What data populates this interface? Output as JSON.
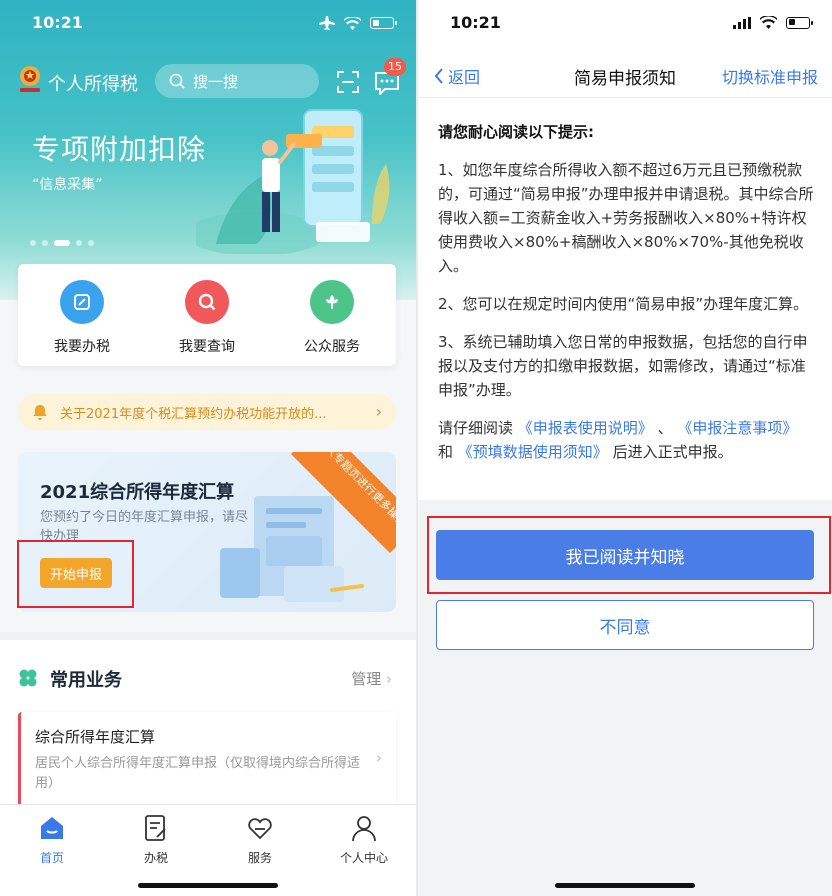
{
  "left": {
    "status_time": "10:21",
    "app_title": "个人所得税",
    "search_placeholder": "搜一搜",
    "badge_count": "15",
    "banner": {
      "title": "专项附加扣除",
      "subtitle": "“信息采集”"
    },
    "shortcuts": [
      {
        "label": "我要办税",
        "color": "#3aa3f0"
      },
      {
        "label": "我要查询",
        "color": "#f0585a"
      },
      {
        "label": "公众服务",
        "color": "#4cc48a"
      }
    ],
    "notice": "关于2021年度个税汇算预约办税功能开放的...",
    "annual_card": {
      "title": "2021综合所得年度汇算",
      "desc": "您预约了今日的年度汇算申报，请尽快办理",
      "start_button": "开始申报",
      "ribbon": "进入专题页进行更多操作"
    },
    "common": {
      "title": "常用业务",
      "manage": "管理",
      "item_title": "综合所得年度汇算",
      "item_desc": "居民个人综合所得年度汇算申报（仅取得境内综合所得适用）"
    },
    "tabs": [
      "首页",
      "办税",
      "服务",
      "个人中心"
    ]
  },
  "right": {
    "status_time": "10:21",
    "back": "返回",
    "title": "简易申报须知",
    "switch": "切换标准申报",
    "heading": "请您耐心阅读以下提示:",
    "p1": "1、如您年度综合所得收入额不超过6万元且已预缴税款的，可通过“简易申报”办理申报并申请退税。其中综合所得收入额=工资薪金收入+劳务报酬收入×80%+特许权使用费收入×80%+稿酬收入×80%×70%-其他免税收入。",
    "p2": "2、您可以在规定时间内使用“简易申报”办理年度汇算。",
    "p3": "3、系统已辅助填入您日常的申报数据，包括您的自行申报以及支付方的扣缴申报数据，如需修改，请通过“标准申报”办理。",
    "p4_pre": "请仔细阅读",
    "p4_link1": "《申报表使用说明》",
    "p4_sep": "、",
    "p4_link2": "《申报注意事项》",
    "p4_and": "和",
    "p4_link3": "《预填数据使用须知》",
    "p4_post": "后进入正式申报。",
    "agree": "我已阅读并知晓",
    "disagree": "不同意"
  }
}
